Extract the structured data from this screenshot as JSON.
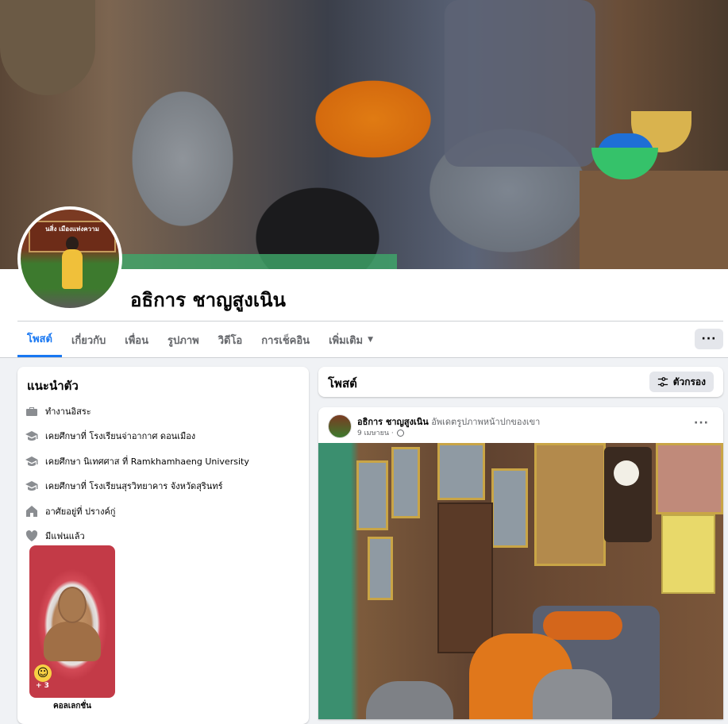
{
  "profile": {
    "name": "อธิการ ชาญสูงเนิน",
    "avatar_sign_text": "นสิ่ง เมืองแห่งความ"
  },
  "tabs": [
    {
      "label": "โพสต์",
      "active": true
    },
    {
      "label": "เกี่ยวกับ",
      "active": false
    },
    {
      "label": "เพื่อน",
      "active": false
    },
    {
      "label": "รูปภาพ",
      "active": false
    },
    {
      "label": "วิดีโอ",
      "active": false
    },
    {
      "label": "การเช็คอิน",
      "active": false
    },
    {
      "label": "เพิ่มเติม",
      "active": false,
      "caret": true
    }
  ],
  "more_button_label": "···",
  "intro": {
    "title": "แนะนำตัว",
    "items": [
      {
        "icon": "briefcase-icon",
        "text": "ทำงานอิสระ"
      },
      {
        "icon": "graduation-cap-icon",
        "text": "เคยศึกษาที่ โรงเรียนจ่าอากาศ ดอนเมือง"
      },
      {
        "icon": "graduation-cap-icon",
        "text": "เคยศึกษา นิเทศศาส ที่ Ramkhamhaeng University"
      },
      {
        "icon": "graduation-cap-icon",
        "text": "เคยศึกษาที่ โรงเรียนสุรวิทยาคาร จังหวัดสุรินทร์"
      },
      {
        "icon": "home-icon",
        "text": "อาศัยอยู่ที่ ปรางค์กู่"
      },
      {
        "icon": "heart-icon",
        "text": "มีแฟนแล้ว"
      }
    ],
    "featured": {
      "label": "คอลเลกชั่น",
      "count": "+ 3"
    }
  },
  "posts_header": {
    "title": "โพสต์",
    "filter_label": "ตัวกรอง"
  },
  "post": {
    "author": "อธิการ ชาญสูงเนิน",
    "action": "อัพเดตรูปภาพหน้าปกของเขา",
    "date": "9 เมษายน ·",
    "menu": "···"
  },
  "colors": {
    "accent": "#1877f2",
    "background": "#f0f2f5",
    "secondary_text": "#65676b"
  }
}
